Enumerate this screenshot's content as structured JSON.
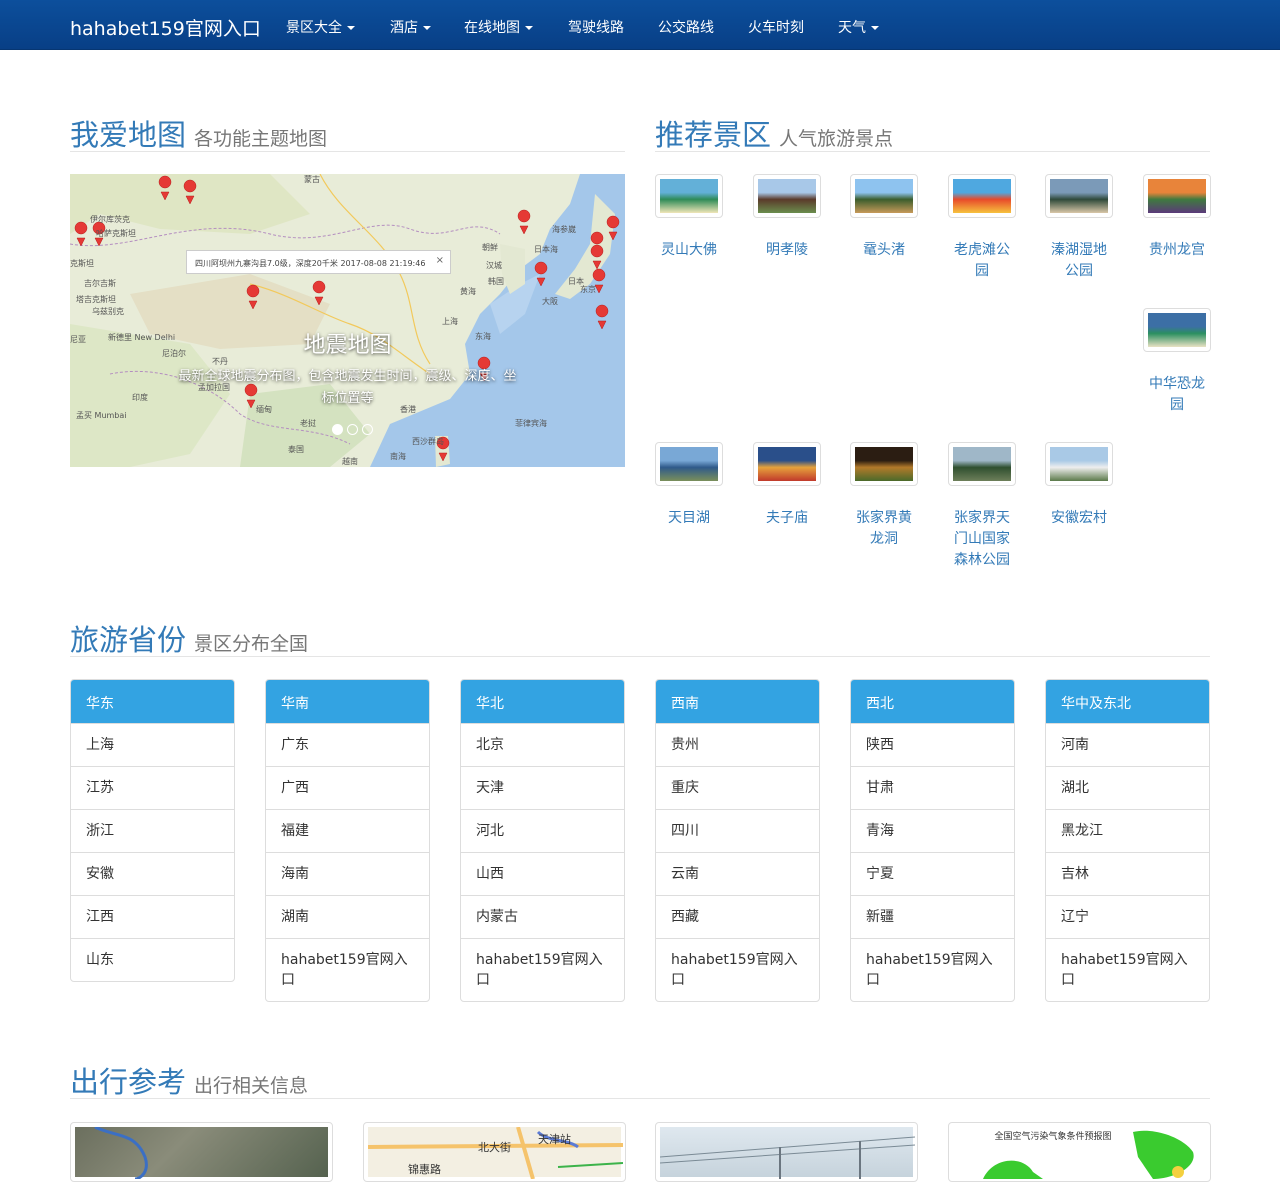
{
  "navbar": {
    "brand": "hahabet159官网入口",
    "items": [
      {
        "label": "景区大全",
        "dropdown": true
      },
      {
        "label": "酒店",
        "dropdown": true
      },
      {
        "label": "在线地图",
        "dropdown": true
      },
      {
        "label": "驾驶线路",
        "dropdown": false
      },
      {
        "label": "公交路线",
        "dropdown": false
      },
      {
        "label": "火车时刻",
        "dropdown": false
      },
      {
        "label": "天气",
        "dropdown": true
      }
    ]
  },
  "map_section": {
    "title": "我爱地图",
    "subtitle": "各功能主题地图",
    "carousel": {
      "caption_title": "地震地图",
      "caption_text": "最新全球地震分布图，包含地震发生时间，震级、深度、坐标位置等",
      "popup_text": "四川阿坝州九寨沟县7.0级，深度20千米    2017-08-08 21:19:46",
      "popup_close": "×",
      "map_labels": [
        "蒙古",
        "朝鲜",
        "韩国",
        "日本",
        "日本海",
        "黄海",
        "东海",
        "上海",
        "印度",
        "缅甸",
        "老挝",
        "泰国",
        "越南",
        "南海",
        "菲律宾海",
        "尼泊尔",
        "不丹",
        "孟加拉国",
        "新德里 New Delhi",
        "孟买 Mumbai",
        "克斯坦",
        "尼亚",
        "海参崴",
        "东京",
        "大阪",
        "汉城",
        "香港",
        "西沙群岛",
        "伊尔库茨克",
        "哈萨克斯坦",
        "吉尔吉斯",
        "塔吉克斯坦",
        "乌兹别克"
      ]
    }
  },
  "scenic_section": {
    "title": "推荐景区",
    "subtitle": "人气旅游景点",
    "items": [
      {
        "name": "灵山大佛",
        "palette": [
          "#63b0d8",
          "#2e8b57",
          "#f0e6b8"
        ]
      },
      {
        "name": "明孝陵",
        "palette": [
          "#a8c8e8",
          "#5a3a2a",
          "#6b8e4e"
        ]
      },
      {
        "name": "鼋头渚",
        "palette": [
          "#8ec3ef",
          "#3b5d2d",
          "#c79a5a"
        ]
      },
      {
        "name": "老虎滩公园",
        "palette": [
          "#4fa8e0",
          "#e84a2a",
          "#f6c23e"
        ]
      },
      {
        "name": "溱湖湿地公园",
        "palette": [
          "#7b9ab8",
          "#2f4a3a",
          "#d9c7a8"
        ]
      },
      {
        "name": "贵州龙宫",
        "palette": [
          "#e8843a",
          "#3f7a3f",
          "#5b3a7a"
        ]
      },
      {
        "name": "中华恐龙园",
        "palette": [
          "#3c6fa5",
          "#2b8f60",
          "#e9e2c4"
        ]
      },
      {
        "name": "天目湖",
        "palette": [
          "#79a8d6",
          "#2f5a8a",
          "#7a8f5a"
        ]
      },
      {
        "name": "夫子庙",
        "palette": [
          "#2a4f8a",
          "#e6a23c",
          "#c0392b"
        ]
      },
      {
        "name": "张家界黄龙洞",
        "palette": [
          "#2b1d12",
          "#b37a2a",
          "#4a6a2a"
        ]
      },
      {
        "name": "张家界天门山国家森林公园",
        "palette": [
          "#9fb7c8",
          "#2f4f2f",
          "#6d7f5a"
        ]
      },
      {
        "name": "安徽宏村",
        "palette": [
          "#a9c9e6",
          "#eeeeee",
          "#5b7a4a"
        ]
      }
    ]
  },
  "province_section": {
    "title": "旅游省份",
    "subtitle": "景区分布全国",
    "regions": [
      {
        "name": "华东",
        "provinces": [
          "上海",
          "江苏",
          "浙江",
          "安徽",
          "江西",
          "山东"
        ]
      },
      {
        "name": "华南",
        "provinces": [
          "广东",
          "广西",
          "福建",
          "海南",
          "湖南",
          "hahabet159官网入口"
        ]
      },
      {
        "name": "华北",
        "provinces": [
          "北京",
          "天津",
          "河北",
          "山西",
          "内蒙古",
          "hahabet159官网入口"
        ]
      },
      {
        "name": "西南",
        "provinces": [
          "贵州",
          "重庆",
          "四川",
          "云南",
          "西藏",
          "hahabet159官网入口"
        ]
      },
      {
        "name": "西北",
        "provinces": [
          "陕西",
          "甘肃",
          "青海",
          "宁夏",
          "新疆",
          "hahabet159官网入口"
        ]
      },
      {
        "name": "华中及东北",
        "provinces": [
          "河南",
          "湖北",
          "黑龙江",
          "吉林",
          "辽宁",
          "hahabet159官网入口"
        ]
      }
    ]
  },
  "travel_section": {
    "title": "出行参考",
    "subtitle": "出行相关信息",
    "cards": [
      {
        "name": "satellite-map",
        "labels": []
      },
      {
        "name": "city-map",
        "labels": [
          "北大街",
          "天津站",
          "锦惠路"
        ]
      },
      {
        "name": "railway-photo",
        "labels": []
      },
      {
        "name": "air-pollution-forecast",
        "labels": [
          "全国空气污染气象条件预报图"
        ]
      }
    ]
  },
  "colors": {
    "navbar": "#0a4a94",
    "link": "#337ab7",
    "panel_header": "#33a3e2",
    "pin": "#e53935"
  }
}
